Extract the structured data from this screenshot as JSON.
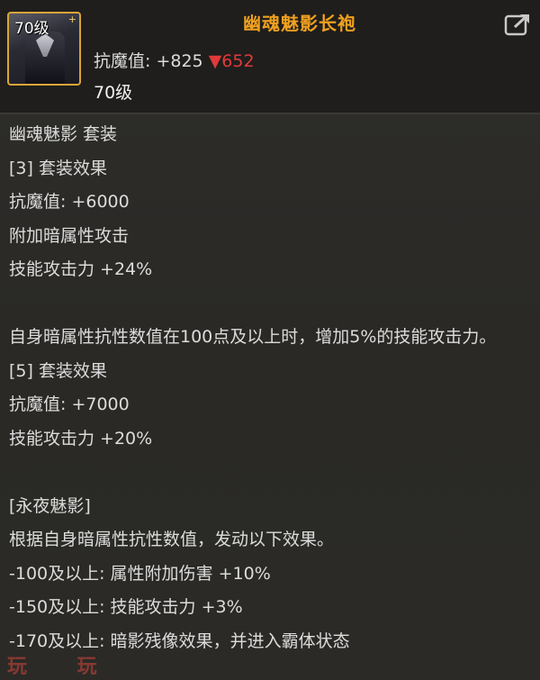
{
  "item": {
    "name": "幽魂魅影长袍",
    "icon_level": "70级",
    "stat_label": "抗魔值:",
    "stat_value": "+825",
    "stat_diff": "▼652",
    "level": "70级"
  },
  "set": {
    "title": "幽魂魅影  套装",
    "bonus3_header": "[3] 套装效果",
    "bonus3_lines": [
      "抗魔值: +6000",
      "附加暗属性攻击",
      "技能攻击力 +24%"
    ],
    "bonus3_extra": "自身暗属性抗性数值在100点及以上时，增加5%的技能攻击力。",
    "bonus5_header": "[5] 套装效果",
    "bonus5_lines": [
      "抗魔值: +7000",
      "技能攻击力 +20%"
    ],
    "special_header": "[永夜魅影]",
    "special_desc": "根据自身暗属性抗性数值，发动以下效果。",
    "special_lines": [
      "-100及以上: 属性附加伤害 +10%",
      "-150及以上: 技能攻击力 +3%",
      "-170及以上: 暗影残像效果，并进入霸体状态"
    ]
  },
  "watermark": "玩 玩",
  "colors": {
    "name": "#f0a020",
    "down": "#e03a3a",
    "frame": "#d9a538"
  },
  "icons": {
    "share": "share-icon"
  }
}
